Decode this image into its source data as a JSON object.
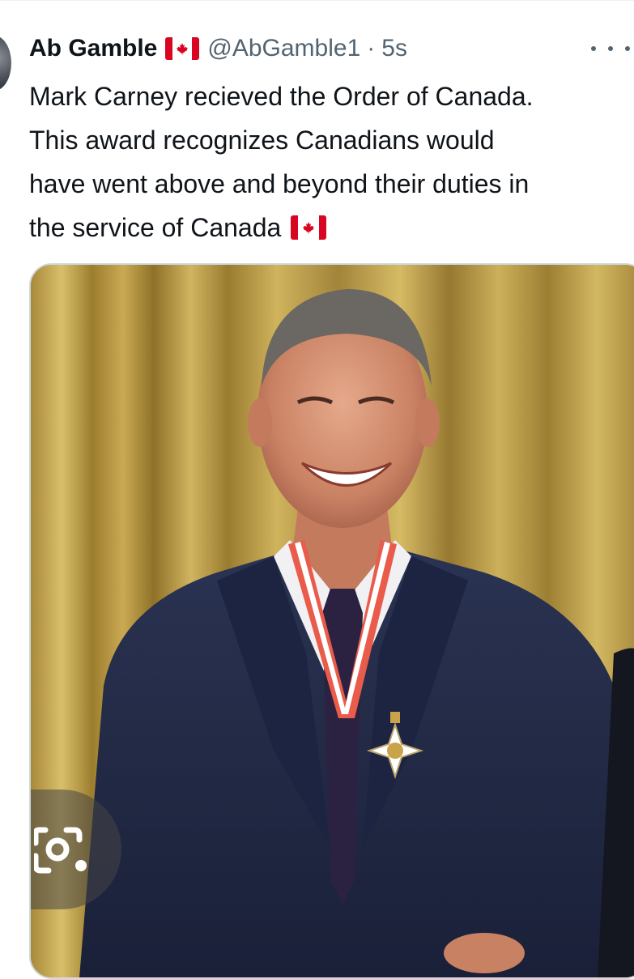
{
  "tweet": {
    "author_name": "Ab Gamble",
    "author_handle": "@AbGamble1",
    "separator": "·",
    "timestamp": "5s",
    "text_lines": [
      "Mark Carney recieved the Order of Canada.",
      "This award recognizes Canadians would",
      "have went above and beyond their duties in",
      "the service of Canada"
    ],
    "name_emoji": "canada-flag",
    "text_emoji": "canada-flag"
  },
  "media": {
    "type": "photo",
    "lens_icon": "camera-lens-icon"
  },
  "colors": {
    "text_primary": "#0f1419",
    "text_secondary": "#536471",
    "flag_red": "#d80621",
    "media_border": "#cfd9de"
  }
}
